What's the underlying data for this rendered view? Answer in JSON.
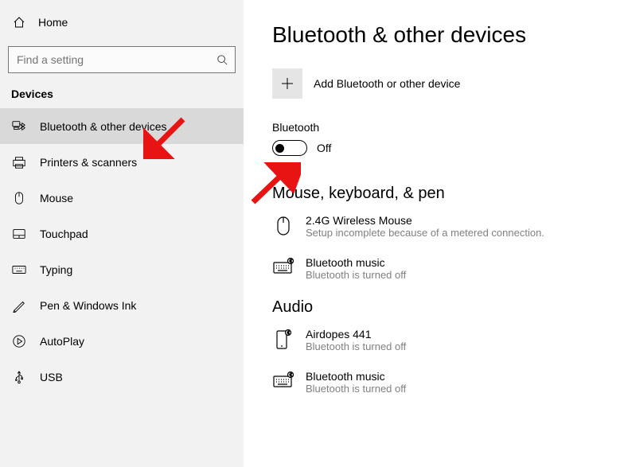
{
  "sidebar": {
    "home": "Home",
    "search_placeholder": "Find a setting",
    "section": "Devices",
    "items": [
      {
        "label": "Bluetooth & other devices"
      },
      {
        "label": "Printers & scanners"
      },
      {
        "label": "Mouse"
      },
      {
        "label": "Touchpad"
      },
      {
        "label": "Typing"
      },
      {
        "label": "Pen & Windows Ink"
      },
      {
        "label": "AutoPlay"
      },
      {
        "label": "USB"
      }
    ]
  },
  "main": {
    "title": "Bluetooth & other devices",
    "add_label": "Add Bluetooth or other device",
    "bt_label": "Bluetooth",
    "bt_state": "Off",
    "groups": [
      {
        "title": "Mouse, keyboard, & pen",
        "devices": [
          {
            "name": "2.4G Wireless Mouse",
            "sub": "Setup incomplete because of a metered connection."
          },
          {
            "name": "Bluetooth music",
            "sub": "Bluetooth is turned off"
          }
        ]
      },
      {
        "title": "Audio",
        "devices": [
          {
            "name": "Airdopes 441",
            "sub": "Bluetooth is turned off"
          },
          {
            "name": "Bluetooth music",
            "sub": "Bluetooth is turned off"
          }
        ]
      }
    ]
  }
}
